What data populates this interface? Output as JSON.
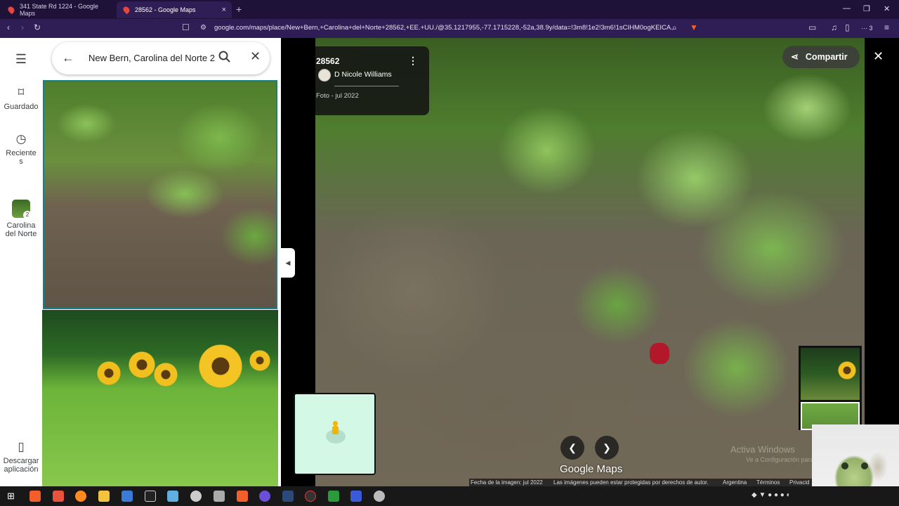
{
  "browser": {
    "tabs": [
      {
        "label": "341 State Rd 1224 - Google Maps",
        "active": false
      },
      {
        "label": "28562 - Google Maps",
        "active": true
      }
    ],
    "close_tab_glyph": "×",
    "new_tab_glyph": "+",
    "url": "google.com/maps/place/New+Bern,+Carolina+del+Norte+28562,+EE.+UU./@35.1217955,-77.1715228,-52a,38.9y/data=!3m8!1e2!3m6!1sCIHM0ogKEICA...",
    "extension_badge": "3"
  },
  "rail": {
    "menu_icon": "menu-icon",
    "items": [
      {
        "label": "Guardado",
        "icon": "bookmark-icon"
      },
      {
        "label": "Reciente",
        "label2": "s",
        "icon": "history-icon"
      },
      {
        "label": "Carolina",
        "label2": "del Norte",
        "icon": "place-thumbnail",
        "badge": "2"
      },
      {
        "label": "Descargar",
        "label2": "aplicación",
        "icon": "phone-icon"
      }
    ]
  },
  "search": {
    "query": "New Bern, Carolina del Norte 2"
  },
  "photo": {
    "title": "28562",
    "author": "D Nicole Williams",
    "meta": "Foto - jul 2022",
    "share_label": "Compartir"
  },
  "footer": {
    "brand": "Google Maps",
    "date": "Fecha de la imagen: jul 2022",
    "rights": "Las imágenes pueden estar protegidas por derechos de autor.",
    "country": "Argentina",
    "terms": "Términos",
    "privacy": "Privacid"
  },
  "watermark": {
    "line1": "Activa Windows",
    "line2": "Ve a Configuración para a"
  },
  "colors": {
    "chrome_dark": "#1e1238",
    "chrome_toolbar": "#2f1e55",
    "maps_accent": "#18808a"
  }
}
